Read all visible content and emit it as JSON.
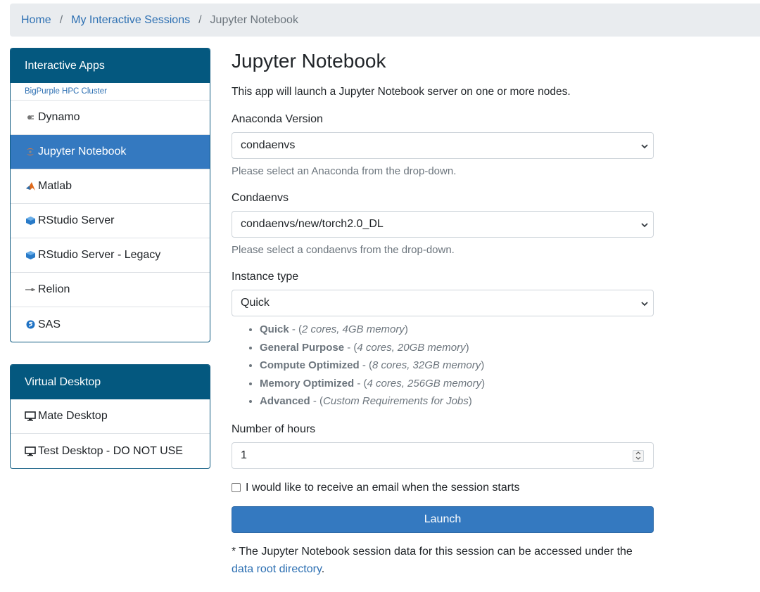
{
  "breadcrumb": {
    "home": "Home",
    "sessions": "My Interactive Sessions",
    "current": "Jupyter Notebook",
    "separator": "/"
  },
  "sidebar": {
    "interactive": {
      "title": "Interactive Apps",
      "cluster": "BigPurple HPC Cluster",
      "items": [
        {
          "label": "Dynamo",
          "icon": "dynamo-icon"
        },
        {
          "label": "Jupyter Notebook",
          "icon": "jupyter-icon",
          "active": true
        },
        {
          "label": "Matlab",
          "icon": "matlab-icon"
        },
        {
          "label": "RStudio Server",
          "icon": "rstudio-icon"
        },
        {
          "label": "RStudio Server - Legacy",
          "icon": "rstudio-icon"
        },
        {
          "label": "Relion",
          "icon": "relion-icon"
        },
        {
          "label": "SAS",
          "icon": "sas-icon"
        }
      ]
    },
    "virtual": {
      "title": "Virtual Desktop",
      "items": [
        {
          "label": "Mate Desktop",
          "icon": "monitor-icon"
        },
        {
          "label": "Test Desktop - DO NOT USE",
          "icon": "monitor-icon"
        }
      ]
    }
  },
  "main": {
    "title": "Jupyter Notebook",
    "description": "This app will launch a Jupyter Notebook server on one or more nodes.",
    "anaconda": {
      "label": "Anaconda Version",
      "value": "condaenvs",
      "help": "Please select an Anaconda from the drop-down."
    },
    "condaenvs": {
      "label": "Condaenvs",
      "value": "condaenvs/new/torch2.0_DL",
      "help": "Please select a condaenvs from the drop-down."
    },
    "instance": {
      "label": "Instance type",
      "value": "Quick",
      "types": [
        {
          "name": "Quick",
          "sep": " - (",
          "spec": "2 cores, 4GB memory",
          "end": ")"
        },
        {
          "name": "General Purpose",
          "sep": " - (",
          "spec": "4 cores, 20GB memory",
          "end": ")"
        },
        {
          "name": "Compute Optimized",
          "sep": " - (",
          "spec": "8 cores, 32GB memory",
          "end": ")"
        },
        {
          "name": "Memory Optimized",
          "sep": " - (",
          "spec": "4 cores, 256GB memory",
          "end": ")"
        },
        {
          "name": "Advanced",
          "sep": " - (",
          "spec": "Custom Requirements for Jobs",
          "end": ")"
        }
      ]
    },
    "hours": {
      "label": "Number of hours",
      "value": "1"
    },
    "email_label": "I would like to receive an email when the session starts",
    "email_checked": false,
    "launch_label": "Launch",
    "note_prefix": "* The Jupyter Notebook session data for this session can be accessed under the ",
    "note_link": "data root directory",
    "note_suffix": "."
  },
  "colors": {
    "panel_header": "#04587f",
    "active_item": "#3479c0",
    "link": "#2c6fb2",
    "breadcrumb_bg": "#e9ecef"
  }
}
